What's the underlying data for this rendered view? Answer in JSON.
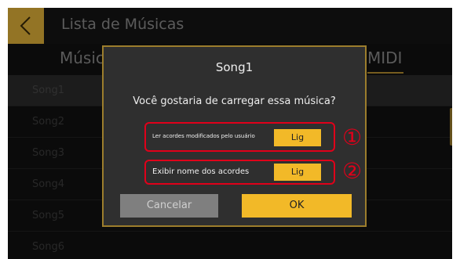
{
  "header": {
    "title": "Lista de Músicas"
  },
  "tabs": [
    {
      "label": "Músic"
    },
    {
      "label": "MIDI"
    }
  ],
  "songs": [
    {
      "name": "Song1"
    },
    {
      "name": "Song2"
    },
    {
      "name": "Song3"
    },
    {
      "name": "Song4"
    },
    {
      "name": "Song5"
    },
    {
      "name": "Song6"
    }
  ],
  "dialog": {
    "title": "Song1",
    "question": "Você gostaria de carregar essa música?",
    "options": [
      {
        "label": "Ler acordes modificados pelo usuário",
        "value": "Lig",
        "marker": "①"
      },
      {
        "label": "Exibir nome dos acordes",
        "value": "Lig",
        "marker": "②"
      }
    ],
    "cancel_label": "Cancelar",
    "ok_label": "OK"
  },
  "colors": {
    "accent": "#f2b928",
    "annotation": "#e0001a",
    "dialog_bg": "#2f2f2f",
    "screen_bg": "#111111"
  },
  "icons": {
    "back": "chevron-left-icon"
  }
}
